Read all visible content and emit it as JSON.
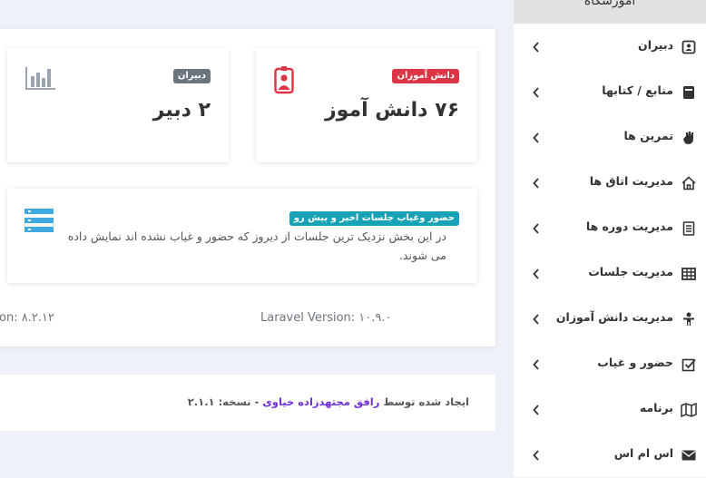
{
  "sidebar": {
    "header": "آموزشگاه",
    "items": [
      {
        "label": "دبیران",
        "icon": "teacher-id-icon"
      },
      {
        "label": "منابع / کتابها",
        "icon": "book-icon"
      },
      {
        "label": "تمرین ها",
        "icon": "hand-icon"
      },
      {
        "label": "مدیریت اتاق ها",
        "icon": "home-icon"
      },
      {
        "label": "مدیریت دوره ها",
        "icon": "document-icon"
      },
      {
        "label": "مدیریت جلسات",
        "icon": "table-icon"
      },
      {
        "label": "مدیریت دانش آموزان",
        "icon": "student-icon"
      },
      {
        "label": "حضور و غیاب",
        "icon": "checkbox-icon"
      },
      {
        "label": "برنامه",
        "icon": "map-icon"
      },
      {
        "label": "اس ام اس",
        "icon": "envelope-icon"
      }
    ]
  },
  "stats": {
    "students": {
      "badge": "دانش آموزان",
      "value": "۷۶ دانش آموز",
      "icon": "student-badge-icon"
    },
    "teachers": {
      "badge": "دبیران",
      "value": "۲ دبیر",
      "icon": "bar-chart-icon"
    }
  },
  "sessions": {
    "badge": "حضور وغیاب جلسات اخیر و پیش رو",
    "description": "در این بخش نزدیک ترین جلسات از دیروز که حضور و غیاب نشده اند نمایش داده می شوند.",
    "icon": "list-icon"
  },
  "versions": {
    "laravel": "Laravel Version: ۱۰.۹.۰",
    "php": "on: ۸.۲.۱۲"
  },
  "footer": {
    "prefix": "ایجاد شده توسط",
    "author": "رافق مجتهدزاده خیاوی",
    "suffix": "- نسخه: ۲.۱.۱"
  },
  "colors": {
    "accent_red": "#dc3545",
    "badge_gray": "#6c757d",
    "badge_teal": "#17a2b8",
    "author_purple": "#6f2fd6",
    "icon_blue": "#3fa9e0"
  }
}
